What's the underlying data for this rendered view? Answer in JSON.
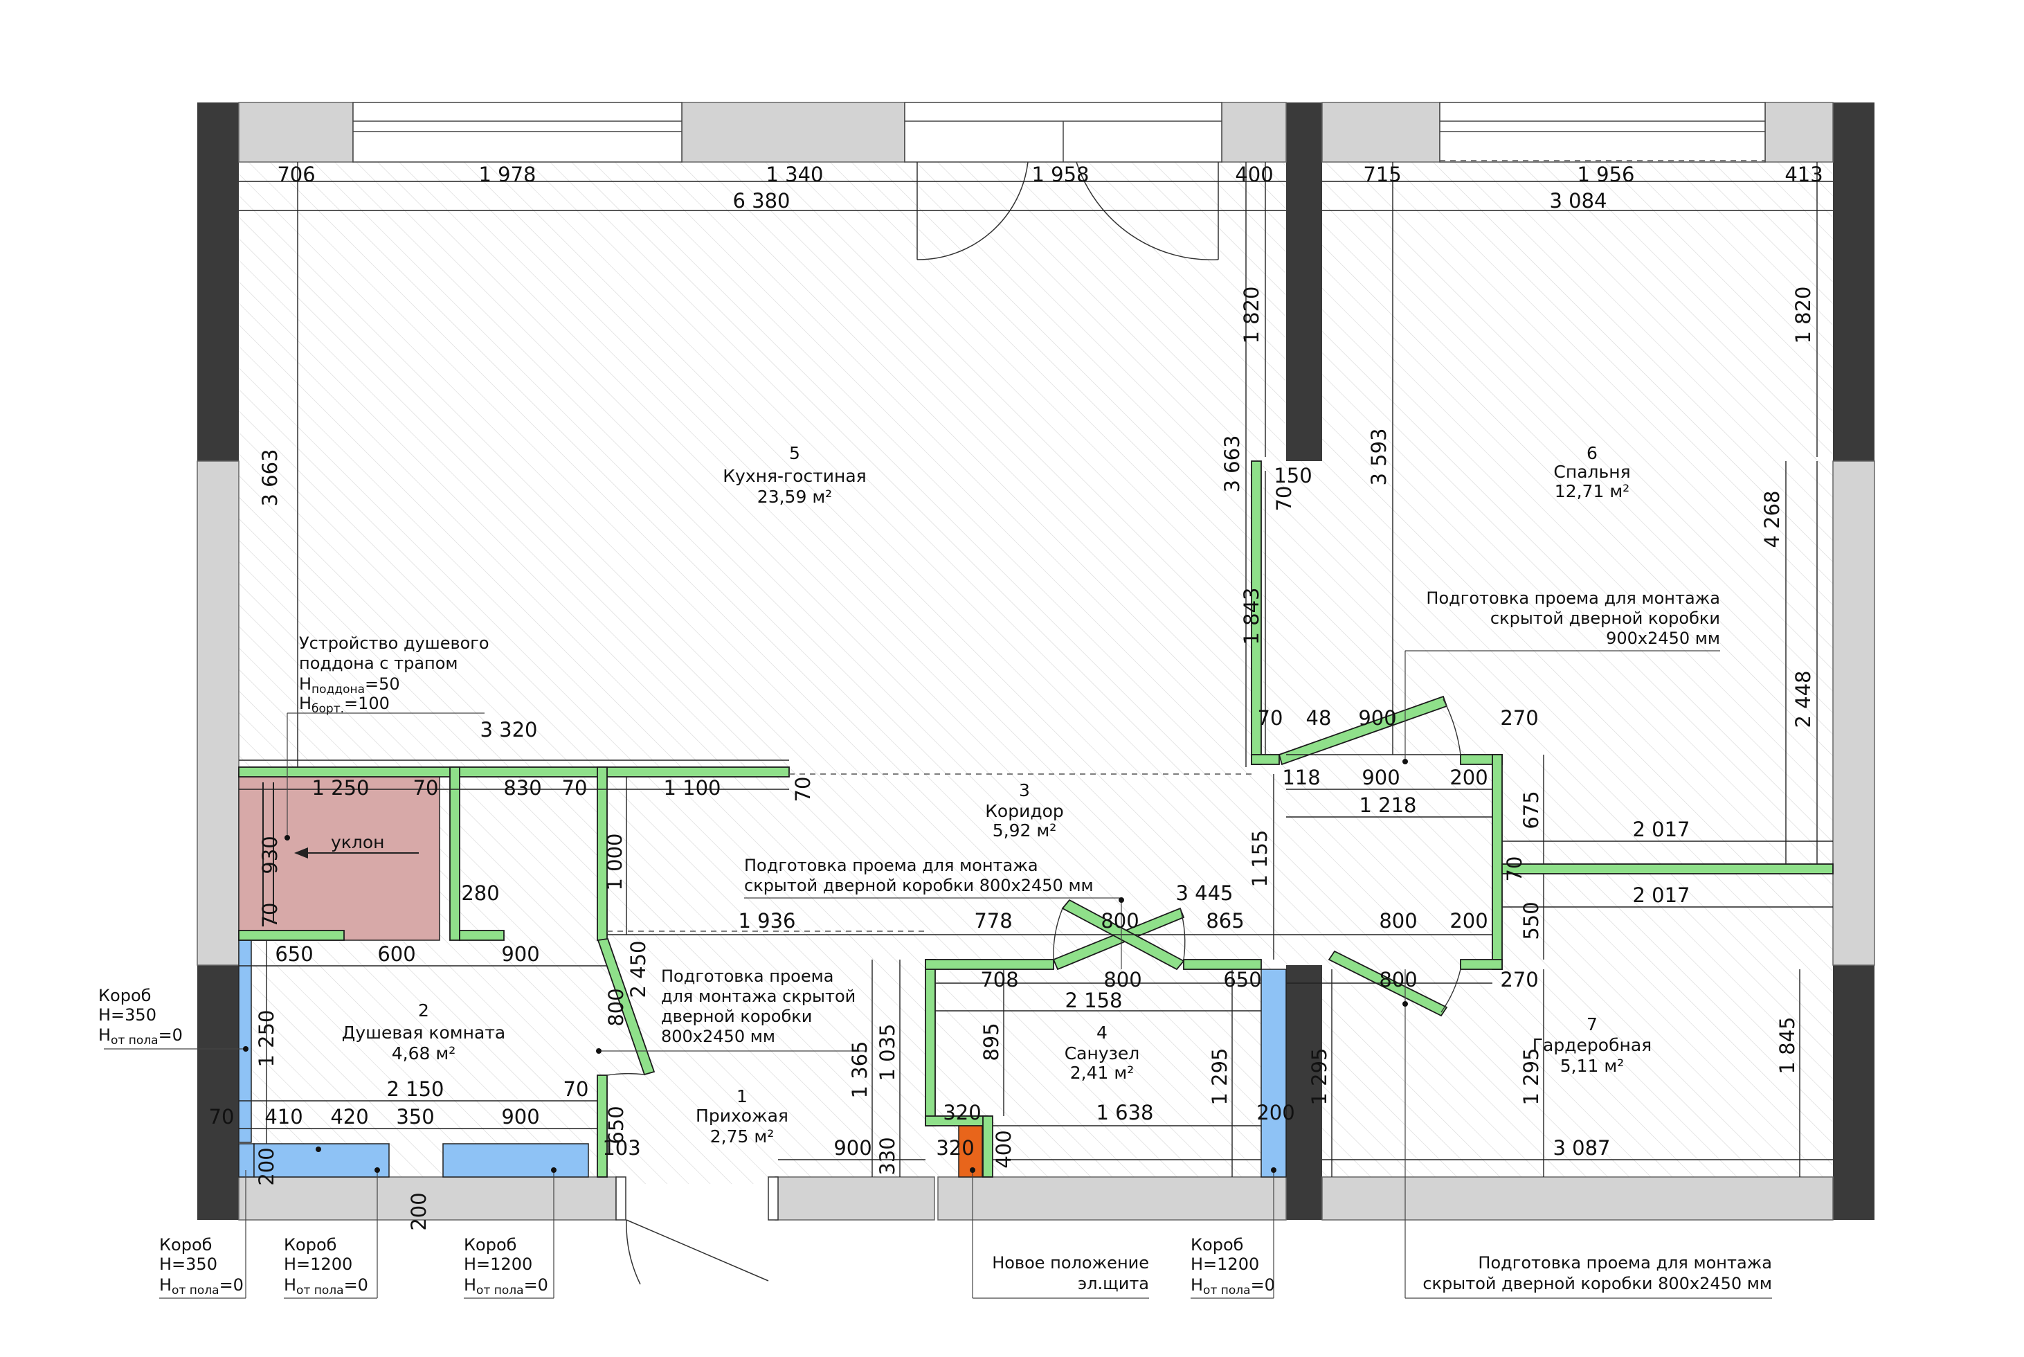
{
  "colors": {
    "wall_bearing": "#3a3a3a",
    "wall_facade": "#cfcfcf",
    "wall_new": "#8fe08a",
    "wall_new_stroke": "#1b1b1b",
    "shower_tray": "#d7a9a8",
    "box": "#8ec2f5",
    "panel": "#e8651b",
    "hatch": "#d8d8d8"
  },
  "rooms": [
    {
      "number": "5",
      "name": "Кухня-гостиная",
      "area": "23,59 м²"
    },
    {
      "number": "6",
      "name": "Спальня",
      "area": "12,71 м²"
    },
    {
      "number": "3",
      "name": "Коридор",
      "area": "5,92 м²"
    },
    {
      "number": "2",
      "name": "Душевая комната",
      "area": "4,68 м²"
    },
    {
      "number": "1",
      "name": "Прихожая",
      "area": "2,75 м²"
    },
    {
      "number": "4",
      "name": "Санузел",
      "area": "2,41 м²"
    },
    {
      "number": "7",
      "name": "Гардеробная",
      "area": "5,11 м²"
    }
  ],
  "slope_label": "уклон",
  "notes": {
    "shower": {
      "line1": "Устройство душевого",
      "line2": "поддона с трапом",
      "h1_base": "H",
      "h1_sub": "поддона",
      "h1_val": "=50",
      "h2_base": "H",
      "h2_sub": "борт.",
      "h2_val": "=100"
    },
    "door_bedroom": {
      "line1": "Подготовка проема для монтажа",
      "line2": "скрытой дверной коробки",
      "line3": "900х2450 мм"
    },
    "door_corridor": {
      "line1": "Подготовка проема для монтажа",
      "line2": "скрытой дверной коробки 800х2450 мм"
    },
    "door_shower": {
      "line1": "Подготовка проема",
      "line2": "для монтажа скрытой",
      "line3": "дверной коробки",
      "line4": "800х2450 мм"
    },
    "door_wardrobe": {
      "line1": "Подготовка проема для монтажа",
      "line2": "скрытой дверной коробки 800х2450 мм"
    },
    "panel": {
      "line1": "Новое положение",
      "line2": "эл.щита"
    },
    "box_left": {
      "title": "Короб",
      "h": "H=350",
      "floor_base": "H",
      "floor_sub": "от пола",
      "floor_val": "=0"
    },
    "box_b1": {
      "title": "Короб",
      "h": "H=350",
      "floor_base": "H",
      "floor_sub": "от пола",
      "floor_val": "=0"
    },
    "box_b2": {
      "title": "Короб",
      "h": "H=1200",
      "floor_base": "H",
      "floor_sub": "от пола",
      "floor_val": "=0"
    },
    "box_b3": {
      "title": "Короб",
      "h": "H=1200",
      "floor_base": "H",
      "floor_sub": "от пола",
      "floor_val": "=0"
    },
    "box_b4": {
      "title": "Короб",
      "h": "H=1200",
      "floor_base": "H",
      "floor_sub": "от пола",
      "floor_val": "=0"
    }
  },
  "dimensions": {
    "top_706": "706",
    "top_1978": "1 978",
    "top_1340": "1 340",
    "top_1958": "1 958",
    "top_400": "400",
    "top_715": "715",
    "top_1956": "1 956",
    "top_413": "413",
    "total_6380": "6 380",
    "total_3084": "3 084",
    "v_3663_left": "3 663",
    "v_3663_mid": "3 663",
    "v_1820_a": "1 820",
    "v_1843": "1 843",
    "v_3593": "3 593",
    "v_1820_b": "1 820",
    "v_4268": "4 268",
    "v_2448": "2 448",
    "d_150": "150",
    "d_70_a": "70",
    "d_3320": "3 320",
    "d_1250": "1 250",
    "d_70_b": "70",
    "d_830": "830",
    "d_70_c": "70",
    "d_1100": "1 100",
    "d_70_d": "70",
    "d_70_e": "70",
    "d_48": "48",
    "d_900_a": "900",
    "d_270_a": "270",
    "d_118": "118",
    "d_900_b": "900",
    "d_200_a": "200",
    "d_1218": "1 218",
    "d_675": "675",
    "d_2017_a": "2 017",
    "d_70_f": "70",
    "d_2017_b": "2 017",
    "d_550": "550",
    "d_930": "930",
    "d_70_g": "70",
    "d_1000": "1 000",
    "d_280": "280",
    "d_1936": "1 936",
    "d_778": "778",
    "d_800_a": "800",
    "d_3445": "3 445",
    "d_865": "865",
    "d_800_b": "800",
    "d_200_b": "200",
    "d_1155": "1 155",
    "d_650_a": "650",
    "d_600": "600",
    "d_900_c": "900",
    "d_2450": "2 450",
    "d_800_c": "800",
    "d_708": "708",
    "d_800_d": "800",
    "d_650_b": "650",
    "d_800_e": "800",
    "d_270_b": "270",
    "d_2158": "2 158",
    "d_1250_v": "1 250",
    "d_2150": "2 150",
    "d_70_h": "70",
    "d_1365": "1 365",
    "d_1035": "1 035",
    "d_895": "895",
    "d_1295_a": "1 295",
    "d_1295_b": "1 295",
    "d_1295_c": "1 295",
    "d_1845": "1 845",
    "d_70_i": "70",
    "d_410": "410",
    "d_420": "420",
    "d_350": "350",
    "d_900_d": "900",
    "d_650_c": "650",
    "d_103": "103",
    "d_320_a": "320",
    "d_1638": "1 638",
    "d_200_c": "200",
    "d_900_e": "900",
    "d_320_b": "320",
    "d_330": "330",
    "d_400": "400",
    "d_3087": "3 087",
    "d_200_d": "200",
    "d_200_e": "200"
  }
}
